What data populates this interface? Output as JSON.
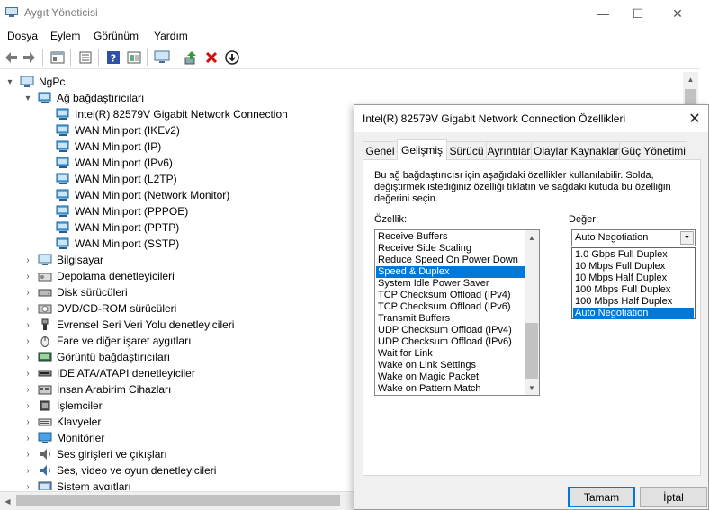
{
  "window": {
    "title": "Aygıt Yöneticisi",
    "controls": {
      "minimize": "—",
      "maximize": "☐",
      "close": "✕"
    }
  },
  "menu": [
    "Dosya",
    "Eylem",
    "Görünüm",
    "Yardım"
  ],
  "toolbar": {
    "icons": [
      "back-icon",
      "forward-icon",
      "properties-icon",
      "show-hide-icon",
      "help-icon",
      "view-icon",
      "computer-icon",
      "update-driver-icon",
      "uninstall-icon",
      "disable-icon"
    ]
  },
  "tree": {
    "root": "NgPc",
    "expanded_category": "Ağ bağdaştırıcıları",
    "adapters": [
      "Intel(R) 82579V Gigabit Network Connection",
      "WAN Miniport (IKEv2)",
      "WAN Miniport (IP)",
      "WAN Miniport (IPv6)",
      "WAN Miniport (L2TP)",
      "WAN Miniport (Network Monitor)",
      "WAN Miniport (PPPOE)",
      "WAN Miniport (PPTP)",
      "WAN Miniport (SSTP)"
    ],
    "categories": [
      "Bilgisayar",
      "Depolama denetleyicileri",
      "Disk sürücüleri",
      "DVD/CD-ROM sürücüleri",
      "Evrensel Seri Veri Yolu denetleyicileri",
      "Fare ve diğer işaret aygıtları",
      "Görüntü bağdaştırıcıları",
      "IDE ATA/ATAPI denetleyiciler",
      "İnsan Arabirim Cihazları",
      "İşlemciler",
      "Klavyeler",
      "Monitörler",
      "Ses girişleri ve çıkışları",
      "Ses, video ve oyun denetleyicileri",
      "Sistem aygıtları"
    ]
  },
  "dialog": {
    "title": "Intel(R) 82579V Gigabit Network Connection Özellikleri",
    "close": "✕",
    "tabs": [
      "Genel",
      "Gelişmiş",
      "Sürücü",
      "Ayrıntılar",
      "Olaylar",
      "Kaynaklar",
      "Güç Yönetimi"
    ],
    "active_tab": "Gelişmiş",
    "description": "Bu ağ bağdaştırıcısı için aşağıdaki özellikler kullanılabilir. Solda, değiştirmek istediğiniz özelliği tıklatın ve sağdaki kutuda bu özelliğin değerini seçin.",
    "property_label": "Özellik:",
    "value_label": "Değer:",
    "properties": [
      "Receive Buffers",
      "Receive Side Scaling",
      "Reduce Speed On Power Down",
      "Speed & Duplex",
      "System Idle Power Saver",
      "TCP Checksum Offload (IPv4)",
      "TCP Checksum Offload (IPv6)",
      "Transmit Buffers",
      "UDP Checksum Offload (IPv4)",
      "UDP Checksum Offload (IPv6)",
      "Wait for Link",
      "Wake on Link Settings",
      "Wake on Magic Packet",
      "Wake on Pattern Match"
    ],
    "selected_property": "Speed & Duplex",
    "value_current": "Auto Negotiation",
    "value_options": [
      "1.0 Gbps Full Duplex",
      "10 Mbps Full Duplex",
      "10 Mbps Half Duplex",
      "100 Mbps Full Duplex",
      "100 Mbps Half Duplex",
      "Auto Negotiation"
    ],
    "ok_label": "Tamam",
    "cancel_label": "İptal"
  },
  "colors": {
    "selection": "#0078d7",
    "dialog_bg": "#f0f0f0"
  }
}
